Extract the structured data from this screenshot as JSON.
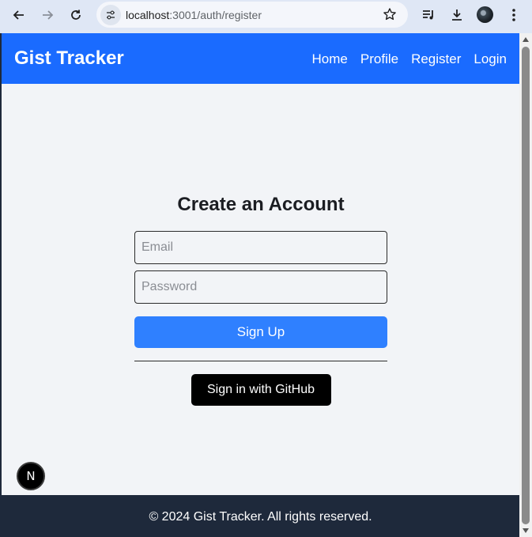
{
  "browser": {
    "url_host": "localhost",
    "url_rest": ":3001/auth/register",
    "icons": [
      "back-arrow-icon",
      "forward-arrow-icon",
      "reload-icon",
      "site-info-icon",
      "bookmark-star-icon",
      "media-playlist-icon",
      "download-icon",
      "profile-avatar",
      "more-menu-icon"
    ]
  },
  "navbar": {
    "brand": "Gist Tracker",
    "links": [
      "Home",
      "Profile",
      "Register",
      "Login"
    ],
    "color": "#1a6bff"
  },
  "form": {
    "title": "Create an Account",
    "email_placeholder": "Email",
    "password_placeholder": "Password",
    "signup_label": "Sign Up",
    "github_label": "Sign in with GitHub",
    "signup_color": "#2f80ff"
  },
  "footer": {
    "text": "© 2024 Gist Tracker. All rights reserved."
  },
  "dev_badge": {
    "label": "N"
  }
}
